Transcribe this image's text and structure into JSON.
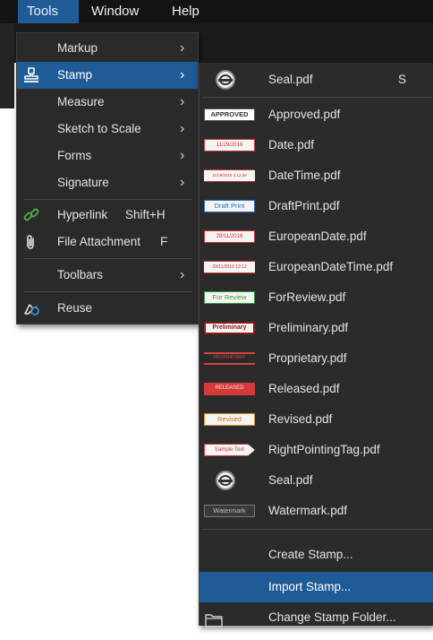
{
  "menubar": {
    "tools": "Tools",
    "window": "Window",
    "help": "Help"
  },
  "tools_menu": {
    "markup": "Markup",
    "stamp": "Stamp",
    "measure": "Measure",
    "sketch_to_scale": "Sketch to Scale",
    "forms": "Forms",
    "signature": "Signature",
    "hyperlink": "Hyperlink",
    "hyperlink_shortcut": "Shift+H",
    "file_attachment": "File Attachment",
    "file_attachment_shortcut": "F",
    "toolbars": "Toolbars",
    "reuse": "Reuse",
    "submenu_arrow": "›"
  },
  "stamp_menu": {
    "items": [
      {
        "label": "Seal.pdf",
        "shortcut": "S"
      },
      {
        "label": "Approved.pdf",
        "thumb_text": "APPROVED"
      },
      {
        "label": "Date.pdf",
        "thumb_text": "11/29/2016"
      },
      {
        "label": "DateTime.pdf",
        "thumb_text": "11/29/2016 1:12:26"
      },
      {
        "label": "DraftPrint.pdf",
        "thumb_text": "Draft Print"
      },
      {
        "label": "EuropeanDate.pdf",
        "thumb_text": "29/11/2016"
      },
      {
        "label": "EuropeanDateTime.pdf",
        "thumb_text": "29/11/2016 13:12"
      },
      {
        "label": "ForReview.pdf",
        "thumb_text": "For Review"
      },
      {
        "label": "Preliminary.pdf",
        "thumb_text": "Preliminary"
      },
      {
        "label": "Proprietary.pdf",
        "thumb_text": "PROPRIETARY"
      },
      {
        "label": "Released.pdf",
        "thumb_text": "RELEASED"
      },
      {
        "label": "Revised.pdf",
        "thumb_text": "Revised"
      },
      {
        "label": "RightPointingTag.pdf",
        "thumb_text": "Sample Text"
      },
      {
        "label": "Seal.pdf"
      },
      {
        "label": "Watermark.pdf",
        "thumb_text": "Watermark"
      }
    ],
    "create_stamp": "Create Stamp...",
    "import_stamp": "Import Stamp...",
    "change_folder": "Change Stamp Folder..."
  },
  "colors": {
    "menu_bg": "#2a2a2a",
    "highlight": "#1f5b96",
    "menubar_bg": "#141414"
  },
  "icons": {
    "stamp": "stamp-icon",
    "hyperlink": "link-icon",
    "attachment": "paperclip-icon",
    "reuse": "reuse-icon",
    "seal": "seal-icon",
    "folder": "folder-icon"
  }
}
